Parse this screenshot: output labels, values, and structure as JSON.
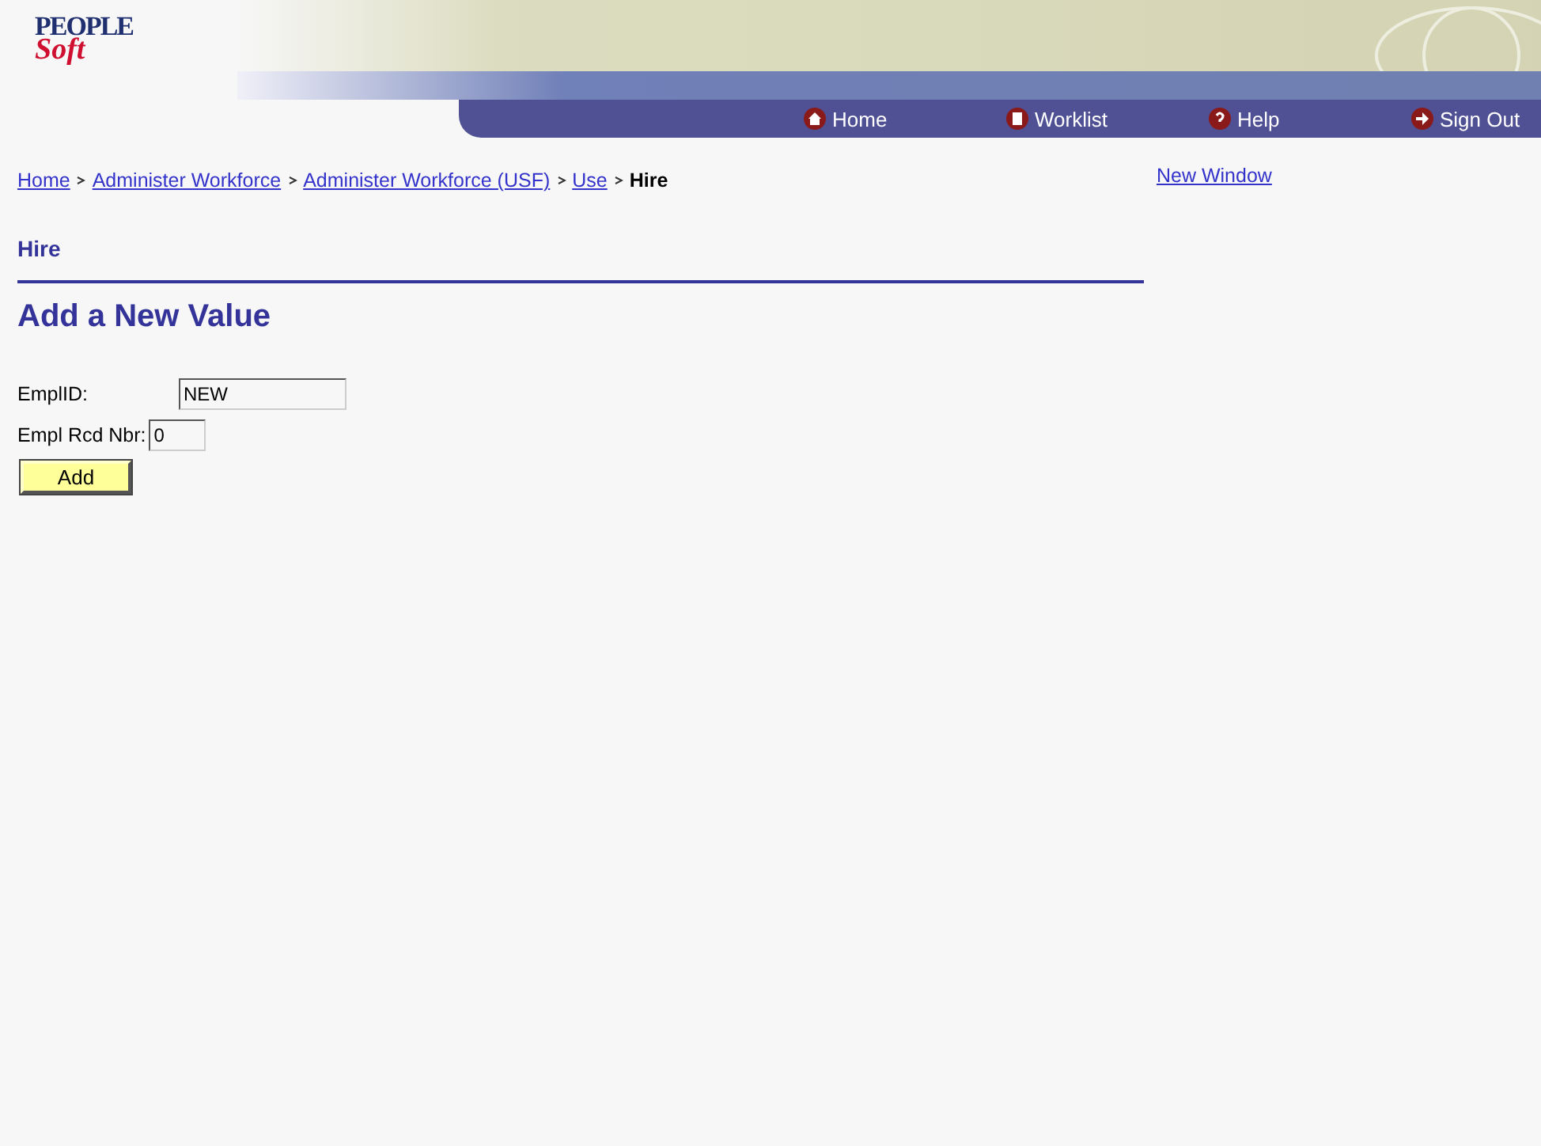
{
  "logo": {
    "line1": "PEOPLE",
    "line2": "Soft"
  },
  "nav": [
    {
      "label": "Home"
    },
    {
      "label": "Worklist"
    },
    {
      "label": "Help"
    },
    {
      "label": "Sign Out"
    }
  ],
  "breadcrumb": {
    "links": [
      "Home",
      "Administer Workforce",
      "Administer Workforce (USF)",
      "Use"
    ],
    "current": "Hire"
  },
  "new_window": "New Window",
  "page_title": "Hire",
  "section_title": "Add a New Value",
  "fields": [
    {
      "label": "EmplID:",
      "value": "NEW"
    },
    {
      "label": "Empl Rcd Nbr:",
      "value": "0"
    }
  ],
  "add_button": "Add"
}
